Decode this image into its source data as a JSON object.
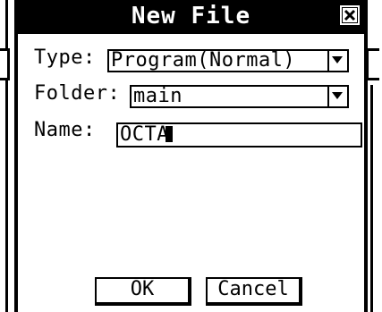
{
  "dialog": {
    "title": "New File",
    "close_icon": "close-x-icon"
  },
  "form": {
    "type_label": "Type:",
    "type_value": "Program(Normal)",
    "folder_label": "Folder:",
    "folder_value": "main",
    "name_label": "Name:",
    "name_value": "OCTA"
  },
  "buttons": {
    "ok": "OK",
    "cancel": "Cancel"
  }
}
